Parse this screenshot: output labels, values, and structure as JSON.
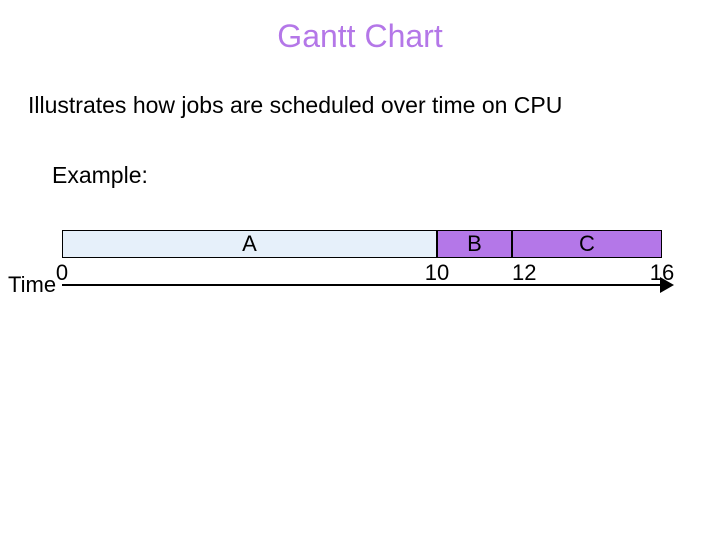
{
  "title": "Gantt Chart",
  "subtitle": "Illustrates how jobs are scheduled over time on CPU",
  "example_label": "Example:",
  "axis_label": "Time",
  "chart_data": {
    "type": "bar",
    "title": "Gantt Chart",
    "xlabel": "Time",
    "ylabel": "",
    "xlim": [
      0,
      16
    ],
    "series": [
      {
        "name": "A",
        "start": 0,
        "end": 10
      },
      {
        "name": "B",
        "start": 10,
        "end": 12
      },
      {
        "name": "C",
        "start": 12,
        "end": 16
      }
    ],
    "ticks": [
      0,
      10,
      12,
      16
    ]
  },
  "segments": {
    "A": "A",
    "B": "B",
    "C": "C"
  },
  "ticks": {
    "t0": "0",
    "t10": "10",
    "t12": "12",
    "t16": "16"
  }
}
